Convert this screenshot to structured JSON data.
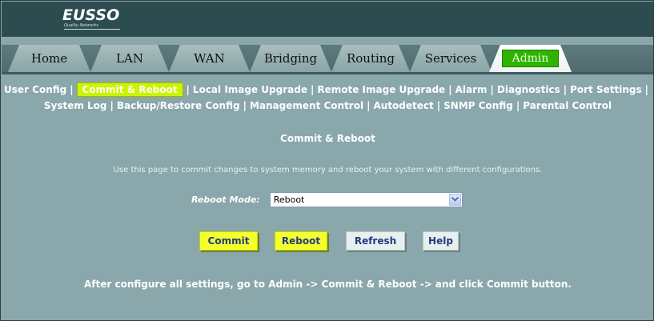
{
  "brand": {
    "logo": "EUSSO",
    "tagline": "Quality Networks"
  },
  "tabs": [
    {
      "label": "Home",
      "active": false
    },
    {
      "label": "LAN",
      "active": false
    },
    {
      "label": "WAN",
      "active": false
    },
    {
      "label": "Bridging",
      "active": false
    },
    {
      "label": "Routing",
      "active": false
    },
    {
      "label": "Services",
      "active": false
    },
    {
      "label": "Admin",
      "active": true
    }
  ],
  "submenu": {
    "row1": [
      "User Config",
      "Commit & Reboot",
      "Local Image Upgrade",
      "Remote Image Upgrade",
      "Alarm",
      "Diagnostics",
      "Port Settings"
    ],
    "row2": [
      "System Log",
      "Backup/Restore Config",
      "Management Control",
      "Autodetect",
      "SNMP Config",
      "Parental Control"
    ],
    "active": "Commit & Reboot",
    "separator": "|"
  },
  "page": {
    "title": "Commit & Reboot",
    "description": "Use this page to commit changes to system memory and reboot your system with different configurations.",
    "reboot_mode_label": "Reboot Mode:",
    "reboot_mode_value": "Reboot"
  },
  "buttons": {
    "commit": "Commit",
    "reboot": "Reboot",
    "refresh": "Refresh",
    "help": "Help"
  },
  "footer_note": "After configure all settings, go to Admin -> Commit & Reboot -> and click Commit button.",
  "colors": {
    "background": "#8aa7ab",
    "header": "#2d4c4f",
    "highlight": "#ccf300",
    "active_tab_pill": "#2eb400",
    "button_highlight": "#f4ff2e"
  }
}
